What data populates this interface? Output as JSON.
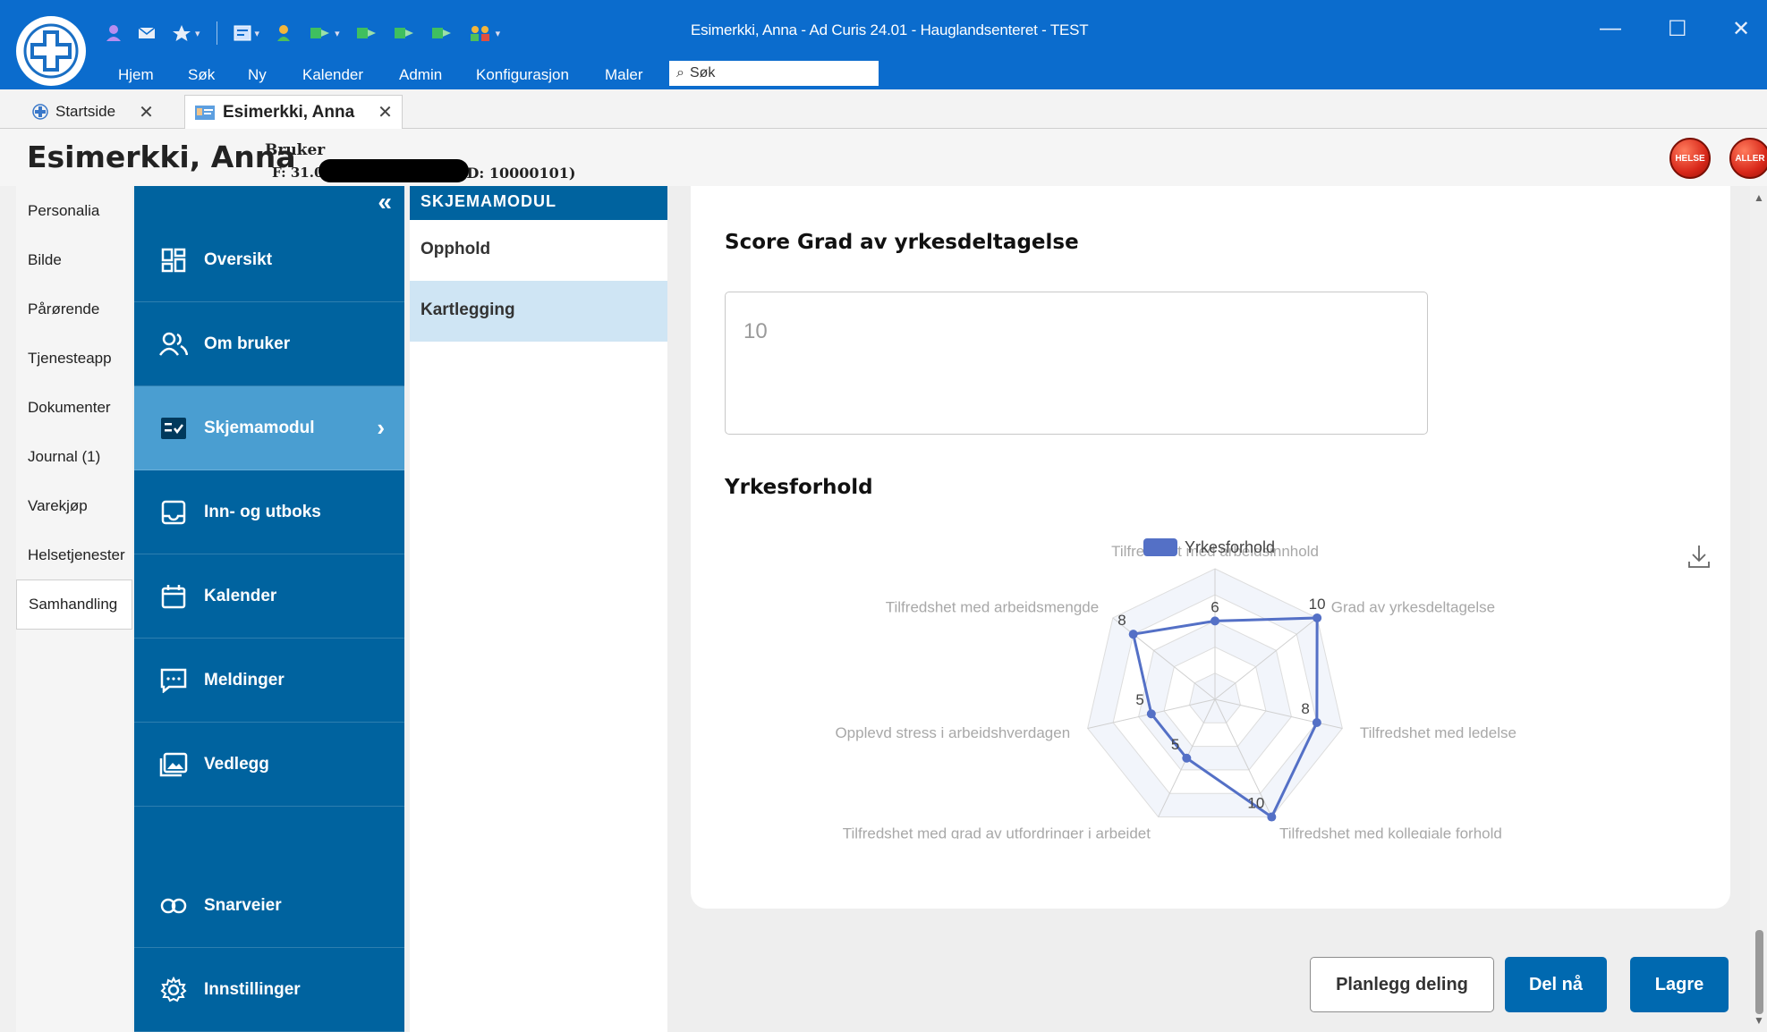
{
  "window": {
    "title": "Esimerkki, Anna - Ad Curis 24.01 - Hauglandsenteret - TEST"
  },
  "menu": {
    "items": [
      "Hjem",
      "Søk",
      "Ny",
      "Kalender",
      "Admin",
      "Konfigurasjon",
      "Maler"
    ],
    "search_placeholder": "Søk"
  },
  "tabs": [
    {
      "label": "Startside"
    },
    {
      "label": "Esimerkki, Anna"
    }
  ],
  "patient": {
    "name": "Esimerkki, Anna",
    "role": "Bruker",
    "dob_prefix": "F: 31.0",
    "id_text": "ID: 10000101)",
    "badges": [
      "HELSE",
      "ALLER"
    ]
  },
  "leftnav": [
    "Personalia",
    "Bilde",
    "Pårørende",
    "Tjenesteapp",
    "Dokumenter",
    "Journal (1)",
    "Varekjøp",
    "Helsetjenester",
    "Samhandling"
  ],
  "sidemenu": {
    "collapse_glyph": "«",
    "items": [
      "Oversikt",
      "Om bruker",
      "Skjemamodul",
      "Inn- og utboks",
      "Kalender",
      "Meldinger",
      "Vedlegg",
      "Snarveier",
      "Innstillinger"
    ],
    "active_chevron": "›"
  },
  "submenu": {
    "header": "SKJEMAMODUL",
    "items": [
      "Opphold",
      "Kartlegging"
    ]
  },
  "form": {
    "score_heading": "Score Grad av yrkesdeltagelse",
    "score_value": "10",
    "chart_heading": "Yrkesforhold"
  },
  "chart_data": {
    "type": "radar",
    "series": [
      {
        "name": "Yrkesforhold",
        "values": [
          6,
          10,
          8,
          10,
          5,
          5,
          8
        ],
        "color": "#5470c6"
      }
    ],
    "axes": [
      "Tilfredshet med arbeidsinnhold",
      "Grad av yrkesdeltagelse",
      "Tilfredshet med ledelse",
      "Tilfredshet med kollegiale forhold",
      "Tilfredshet med grad av utfordringer i arbeidet",
      "Opplevd stress i arbeidshverdagen",
      "Tilfredshet med arbeidsmengde"
    ],
    "max": 10,
    "legend": "top-center"
  },
  "buttons": {
    "plan_share": "Planlegg deling",
    "share_now": "Del nå",
    "save": "Lagre"
  }
}
